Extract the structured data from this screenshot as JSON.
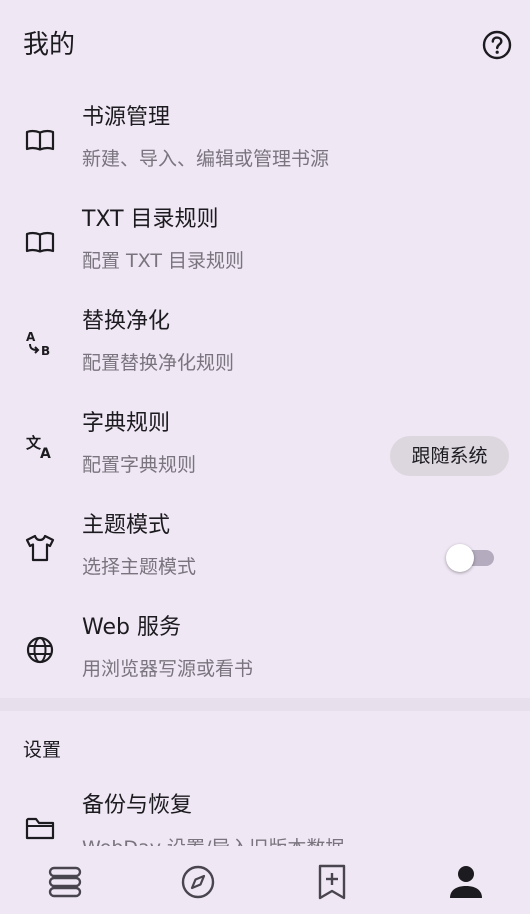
{
  "header": {
    "title": "我的",
    "help_icon": "help-circle-icon"
  },
  "items": [
    {
      "label": "书源管理",
      "sub": "新建、导入、编辑或管理书源",
      "icon": "book-open-icon"
    },
    {
      "label": "TXT 目录规则",
      "sub": "配置 TXT 目录规则",
      "icon": "book-open-icon"
    },
    {
      "label": "替换净化",
      "sub": "配置替换净化规则",
      "icon": "replace-ab-icon"
    },
    {
      "label": "字典规则",
      "sub": "配置字典规则",
      "icon": "translate-icon"
    },
    {
      "label": "主题模式",
      "sub": "选择主题模式",
      "icon": "shirt-icon",
      "value": "跟随系统"
    },
    {
      "label": "Web 服务",
      "sub": "用浏览器写源或看书",
      "icon": "globe-icon",
      "toggle": false
    }
  ],
  "settings": {
    "section_title": "设置",
    "backup": {
      "label": "备份与恢复",
      "sub": "WebDav 设置/导入旧版本数据",
      "icon": "folder-icon"
    }
  },
  "bottom_nav": [
    {
      "name": "bookshelf",
      "icon": "bookshelf-icon",
      "active": false
    },
    {
      "name": "explore",
      "icon": "compass-icon",
      "active": false
    },
    {
      "name": "rss",
      "icon": "bookmark-add-icon",
      "active": false
    },
    {
      "name": "my",
      "icon": "person-icon",
      "active": true
    }
  ],
  "colors": {
    "background": "#EFE7F4",
    "text": "#1C1B1F",
    "secondary_text": "#79747E",
    "chip": "#DCD7DF",
    "switch_track": "#B5ABBE"
  }
}
